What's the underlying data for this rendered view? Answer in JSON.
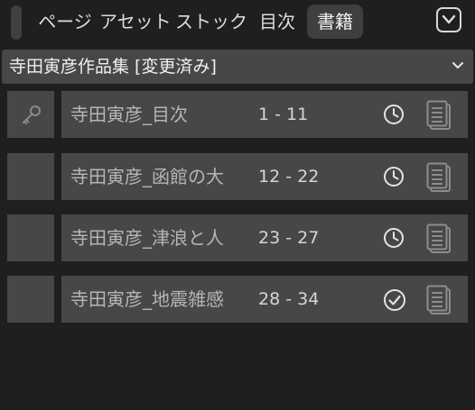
{
  "tabs": [
    {
      "label": "ページ",
      "active": false
    },
    {
      "label": "アセット",
      "active": false
    },
    {
      "label": "ストック",
      "active": false
    },
    {
      "label": "目次",
      "active": false
    },
    {
      "label": "書籍",
      "active": true
    }
  ],
  "book_selector": {
    "value": "寺田寅彦作品集 [変更済み]"
  },
  "rows": [
    {
      "title": "寺田寅彦_目次",
      "range": "1 - 11",
      "status_icon": "clock-icon",
      "has_key": true
    },
    {
      "title": "寺田寅彦_函館の大",
      "range": "12 - 22",
      "status_icon": "clock-icon",
      "has_key": false
    },
    {
      "title": "寺田寅彦_津浪と人",
      "range": "23 - 27",
      "status_icon": "clock-icon",
      "has_key": false
    },
    {
      "title": "寺田寅彦_地震雑感",
      "range": "28 - 34",
      "status_icon": "check-circle-icon",
      "has_key": false
    }
  ],
  "colors": {
    "background": "#1f1f1f",
    "panel": "#474747",
    "active_tab": "#3f3f3f",
    "text_dim": "#b5b5b5"
  }
}
